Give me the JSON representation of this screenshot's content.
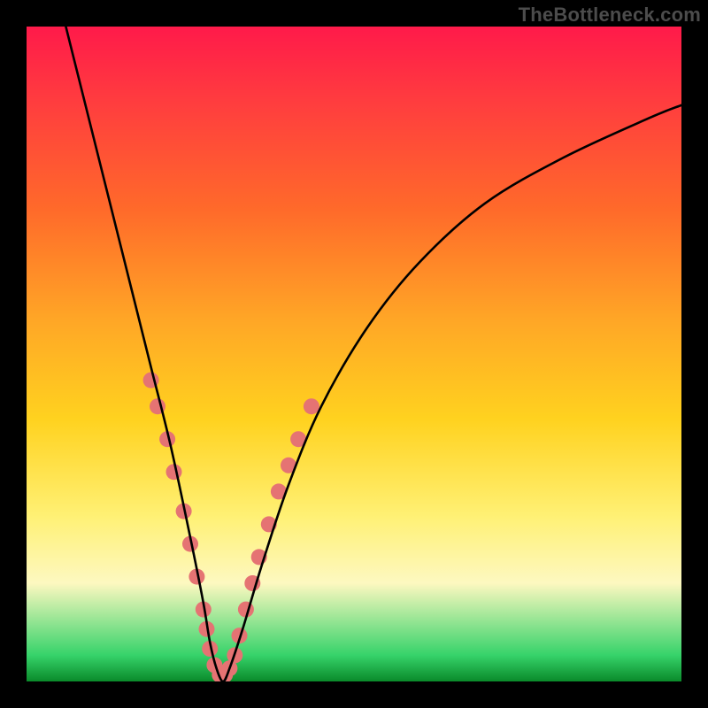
{
  "watermark": "TheBottleneck.com",
  "chart_data": {
    "type": "line",
    "title": "",
    "xlabel": "",
    "ylabel": "",
    "xlim": [
      0,
      100
    ],
    "ylim": [
      0,
      100
    ],
    "grid": false,
    "legend": false,
    "series": [
      {
        "name": "bottleneck-curve",
        "color": "#000000",
        "x": [
          6,
          8,
          10,
          13,
          16,
          19,
          22,
          25,
          27,
          28,
          29,
          30,
          31,
          33,
          36,
          40,
          45,
          52,
          60,
          70,
          82,
          95,
          100
        ],
        "y": [
          100,
          92,
          84,
          72,
          60,
          48,
          36,
          22,
          12,
          6,
          2,
          0,
          2,
          8,
          18,
          30,
          42,
          54,
          64,
          73,
          80,
          86,
          88
        ]
      }
    ],
    "markers": {
      "name": "highlight-dots",
      "color": "#e57373",
      "radius_px": 9,
      "points_xy": [
        [
          19,
          46
        ],
        [
          20,
          42
        ],
        [
          21.5,
          37
        ],
        [
          22.5,
          32
        ],
        [
          24,
          26
        ],
        [
          25,
          21
        ],
        [
          26,
          16
        ],
        [
          27,
          11
        ],
        [
          27.5,
          8
        ],
        [
          28,
          5
        ],
        [
          28.7,
          2.5
        ],
        [
          29.5,
          1
        ],
        [
          30.3,
          1
        ],
        [
          31,
          2
        ],
        [
          31.8,
          4
        ],
        [
          32.5,
          7
        ],
        [
          33.5,
          11
        ],
        [
          34.5,
          15
        ],
        [
          35.5,
          19
        ],
        [
          37,
          24
        ],
        [
          38.5,
          29
        ],
        [
          40,
          33
        ],
        [
          41.5,
          37
        ],
        [
          43.5,
          42
        ]
      ]
    },
    "gradient_background": {
      "direction": "top-to-bottom",
      "stops": [
        {
          "pos": 0.0,
          "color": "#ff1a4a"
        },
        {
          "pos": 0.12,
          "color": "#ff3e3e"
        },
        {
          "pos": 0.28,
          "color": "#ff6a2a"
        },
        {
          "pos": 0.45,
          "color": "#ffa726"
        },
        {
          "pos": 0.6,
          "color": "#ffd21f"
        },
        {
          "pos": 0.75,
          "color": "#fff176"
        },
        {
          "pos": 0.85,
          "color": "#fdf8c0"
        },
        {
          "pos": 0.96,
          "color": "#36d36a"
        },
        {
          "pos": 1.0,
          "color": "#0a8a2a"
        }
      ]
    }
  }
}
